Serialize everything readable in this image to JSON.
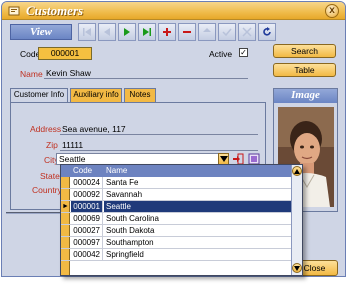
{
  "window": {
    "title": "Customers",
    "close_glyph": "x"
  },
  "view_label": "View",
  "toolbar": {
    "buttons": [
      {
        "name": "first-record-icon",
        "color": "#b8c2da"
      },
      {
        "name": "prior-record-icon",
        "color": "#b8c2da"
      },
      {
        "name": "next-record-icon",
        "color": "#1a9a1a"
      },
      {
        "name": "last-record-icon",
        "color": "#1a9a1a"
      },
      {
        "name": "insert-record-icon",
        "color": "#c81818"
      },
      {
        "name": "delete-record-icon",
        "color": "#c81818"
      },
      {
        "name": "edit-record-icon",
        "color": "#b8c2da"
      },
      {
        "name": "post-record-icon",
        "color": "#b8c2da"
      },
      {
        "name": "cancel-edit-icon",
        "color": "#b8c2da"
      },
      {
        "name": "refresh-icon",
        "color": "#1f3a9a"
      }
    ]
  },
  "form": {
    "code_label": "Code",
    "code_value": "000001",
    "name_label": "Name",
    "name_value": "Kevin Shaw",
    "active_label": "Active",
    "active_check": "✓"
  },
  "side_buttons": {
    "search": "Search",
    "table": "Table"
  },
  "tabs": [
    {
      "label": "Customer Info",
      "active": true
    },
    {
      "label": "Auxiliary info",
      "active": false
    },
    {
      "label": "Notes",
      "active": false
    }
  ],
  "customer_info": {
    "address_label": "Address",
    "address_value": "Sea avenue, 117",
    "zip_label": "Zip",
    "zip_value": "11111",
    "city_label": "City",
    "city_value": "Seattle",
    "state_label": "State",
    "country_label": "Country"
  },
  "image_panel": {
    "title": "Image"
  },
  "close_button": "Close",
  "city_dropdown": {
    "columns": [
      "Code",
      "Name"
    ],
    "rows": [
      {
        "code": "000024",
        "name": "Santa Fe",
        "selected": false
      },
      {
        "code": "000092",
        "name": "Savannah",
        "selected": false
      },
      {
        "code": "000001",
        "name": "Seattle",
        "selected": true
      },
      {
        "code": "000069",
        "name": "South Carolina",
        "selected": false
      },
      {
        "code": "000027",
        "name": "South Dakota",
        "selected": false
      },
      {
        "code": "000097",
        "name": "Southampton",
        "selected": false
      },
      {
        "code": "000042",
        "name": "Springfield",
        "selected": false
      }
    ],
    "current_marker": "►"
  },
  "colors": {
    "accent_orange": "#f2b944",
    "header_blue": "#6d83c0",
    "selection": "#1f3a7a",
    "label_red": "#c03020"
  }
}
